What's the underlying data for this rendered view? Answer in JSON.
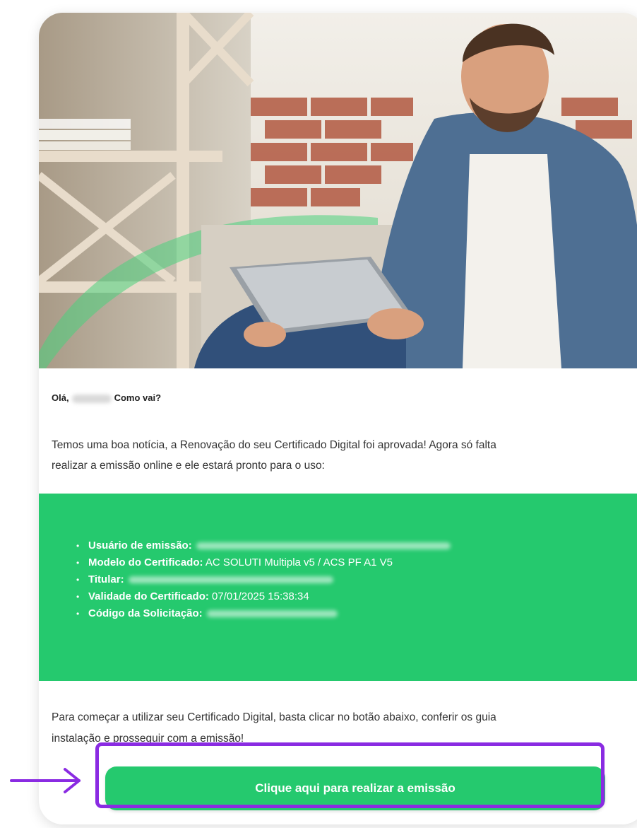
{
  "email": {
    "hero_image": "man-with-tablet-photo",
    "greeting": {
      "prefix": "Olá,",
      "suffix": "Como vai?"
    },
    "intro": {
      "line1": "Temos uma boa notícia, a Renovação do seu Certificado Digital foi aprovada! Agora só falta",
      "line2": "realizar a emissão online e ele estará pronto para o uso:"
    },
    "details": [
      {
        "label": "Usuário de emissão:",
        "value": ""
      },
      {
        "label": "Modelo do Certificado:",
        "value": "AC SOLUTI Multipla v5 / ACS PF A1 V5"
      },
      {
        "label": "Titular:",
        "value": ""
      },
      {
        "label": "Validade do Certificado:",
        "value": "07/01/2025 15:38:34"
      },
      {
        "label": "Código da Solicitação:",
        "value": ""
      }
    ],
    "outro": {
      "line1": "Para começar a utilizar seu Certificado Digital, basta clicar no botão abaixo, conferir os guia",
      "line2": "instalação e prosseguir com a emissão!"
    },
    "cta_label": "Clique aqui para realizar a emissão",
    "colors": {
      "accent_green": "#25c96e",
      "highlight_purple": "#8a2be2"
    },
    "annotation_icon": "arrow-right-icon"
  }
}
